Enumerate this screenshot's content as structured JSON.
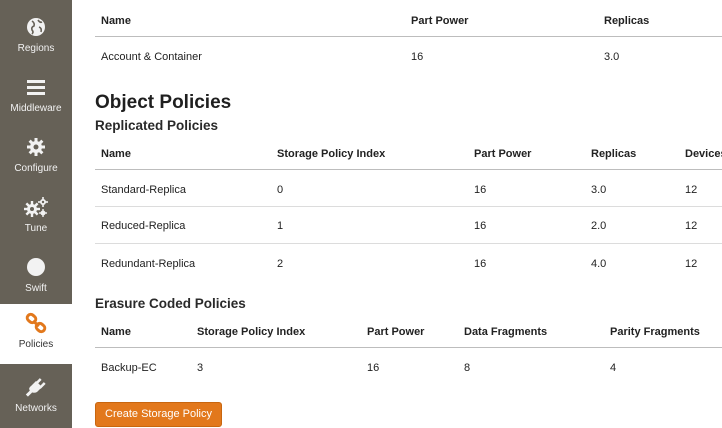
{
  "colors": {
    "sidebar_bg": "#666157",
    "accent": "#e2781c",
    "active_bg": "#ffffff"
  },
  "sidebar": {
    "items": [
      {
        "label": "Regions",
        "icon": "globe-icon"
      },
      {
        "label": "Middleware",
        "icon": "menu-icon"
      },
      {
        "label": "Configure",
        "icon": "gear-icon"
      },
      {
        "label": "Tune",
        "icon": "gears-icon"
      },
      {
        "label": "Swift",
        "icon": "circle-icon"
      },
      {
        "label": "Policies",
        "icon": "chain-link-icon",
        "active": true
      },
      {
        "label": "Networks",
        "icon": "plug-icon"
      }
    ]
  },
  "account_ring": {
    "headers": [
      "Name",
      "Part Power",
      "Replicas"
    ],
    "rows": [
      [
        "Account & Container",
        "16",
        "3.0"
      ]
    ]
  },
  "object_policies": {
    "title": "Object Policies"
  },
  "replicated": {
    "title": "Replicated Policies",
    "headers": [
      "Name",
      "Storage Policy Index",
      "Part Power",
      "Replicas",
      "Devices"
    ],
    "rows": [
      [
        "Standard-Replica",
        "0",
        "16",
        "3.0",
        "12"
      ],
      [
        "Reduced-Replica",
        "1",
        "16",
        "2.0",
        "12"
      ],
      [
        "Redundant-Replica",
        "2",
        "16",
        "4.0",
        "12"
      ]
    ]
  },
  "erasure": {
    "title": "Erasure Coded Policies",
    "headers": [
      "Name",
      "Storage Policy Index",
      "Part Power",
      "Data Fragments",
      "Parity Fragments"
    ],
    "rows": [
      [
        "Backup-EC",
        "3",
        "16",
        "8",
        "4"
      ]
    ]
  },
  "actions": {
    "create_label": "Create Storage Policy"
  }
}
